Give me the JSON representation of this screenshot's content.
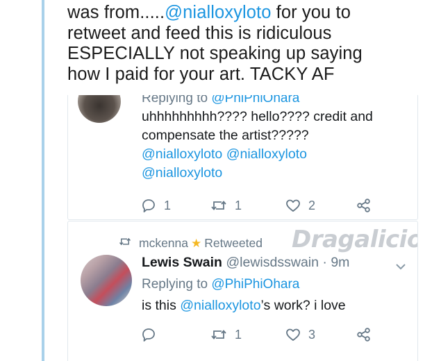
{
  "quoted_tweet": {
    "lines": [
      {
        "prefix": "was from.....",
        "link": "@nialloxyloto",
        "suffix": " for you to"
      },
      {
        "prefix": "retweet and feed this is ridiculous",
        "link": "",
        "suffix": ""
      },
      {
        "prefix": "ESPECIALLY not speaking up saying",
        "link": "",
        "suffix": ""
      },
      {
        "prefix": "how I paid for your art. TACKY AF",
        "link": "",
        "suffix": ""
      }
    ]
  },
  "reply1": {
    "replying_label": "Replying to ",
    "replying_handle": "@PhiPhiOhara",
    "text_line1": "uhhhhhhhhh???? hello???? credit and",
    "text_line2": "compensate the artist?????",
    "mentions": [
      "@nialloxyloto",
      "@nialloxyloto",
      "@nialloxyloto"
    ],
    "counts": {
      "replies": "1",
      "retweets": "1",
      "likes": "2"
    }
  },
  "reply2": {
    "retweeter": "mckenna",
    "retweeted_label": "Retweeted",
    "author_name": "Lewis Swain",
    "author_handle": "@lewisdsswain",
    "time": "9m",
    "replying_label": "Replying to ",
    "replying_handle": "@PhiPhiOhara",
    "text_prefix": "is this ",
    "text_link": "@nialloxyloto",
    "text_suffix": "’s work? i love",
    "counts": {
      "replies": "",
      "retweets": "1",
      "likes": "3"
    }
  },
  "watermark": "Dragalicious",
  "colors": {
    "link": "#1b95e0",
    "muted": "#657786",
    "rule": "#a9d1ea",
    "star": "#f5b823"
  },
  "icons": [
    "reply-icon",
    "retweet-icon",
    "like-icon",
    "share-icon",
    "star-icon",
    "chevron-down-icon"
  ]
}
